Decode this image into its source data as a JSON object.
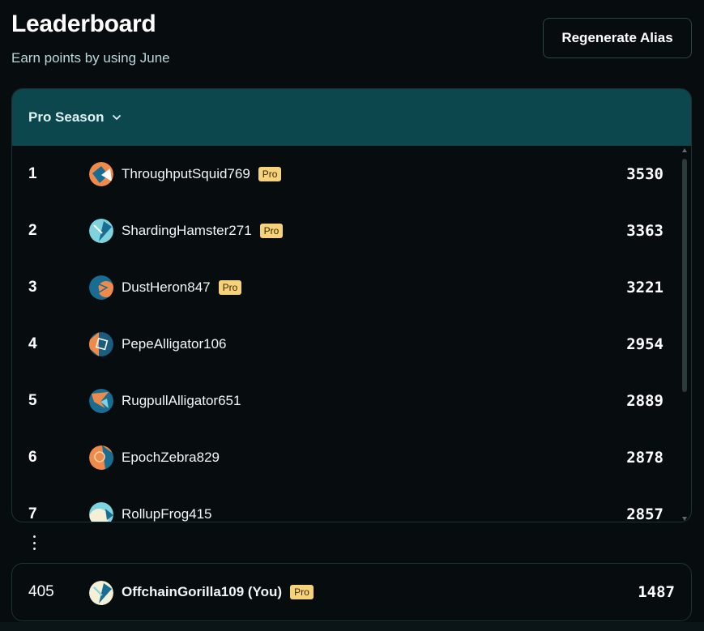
{
  "header": {
    "title": "Leaderboard",
    "subtitle": "Earn points by using June",
    "regenerate_label": "Regenerate Alias"
  },
  "board": {
    "season_label": "Pro Season",
    "rows": [
      {
        "rank": "1",
        "name": "ThroughputSquid769",
        "badge": "Pro",
        "points": "3530",
        "avatar": {
          "bg": "#f08a4b",
          "fg": "#1a6d92",
          "accent": "#ffffff"
        }
      },
      {
        "rank": "2",
        "name": "ShardingHamster271",
        "badge": "Pro",
        "points": "3363",
        "avatar": {
          "bg": "#7dd3e0",
          "fg": "#1a6d92",
          "accent": "#ffffff"
        }
      },
      {
        "rank": "3",
        "name": "DustHeron847",
        "badge": "Pro",
        "points": "3221",
        "avatar": {
          "bg": "#1a6d92",
          "fg": "#f08a4b",
          "accent": "#f08a4b"
        }
      },
      {
        "rank": "4",
        "name": "PepeAlligator106",
        "badge": "",
        "points": "2954",
        "avatar": {
          "bg": "#1a5d7e",
          "fg": "#f08a4b",
          "accent": "#ffffff"
        }
      },
      {
        "rank": "5",
        "name": "RugpullAlligator651",
        "badge": "",
        "points": "2889",
        "avatar": {
          "bg": "#1a6d92",
          "fg": "#f08a4b",
          "accent": "#7dd3e0"
        }
      },
      {
        "rank": "6",
        "name": "EpochZebra829",
        "badge": "",
        "points": "2878",
        "avatar": {
          "bg": "#f08a4b",
          "fg": "#1a6d92",
          "accent": "#f08a4b"
        }
      },
      {
        "rank": "7",
        "name": "RollupFrog415",
        "badge": "",
        "points": "2857",
        "avatar": {
          "bg": "#7dd3e0",
          "fg": "#f4f0d8",
          "accent": "#1a6d92"
        }
      }
    ]
  },
  "you": {
    "rank": "405",
    "name": "OffchainGorilla109 (You)",
    "badge": "Pro",
    "points": "1487",
    "avatar": {
      "bg": "#f4f0d8",
      "fg": "#1a6d92",
      "accent": "#7dd3e0"
    }
  }
}
